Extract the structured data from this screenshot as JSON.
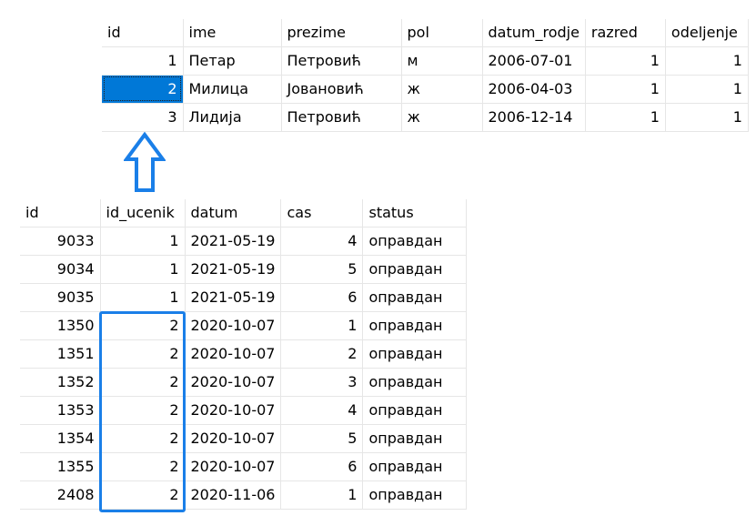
{
  "ucenici": {
    "columns": [
      "id",
      "ime",
      "prezime",
      "pol",
      "datum_rodje",
      "razred",
      "odeljenje"
    ],
    "rows": [
      [
        "1",
        "Петар",
        "Петровић",
        "м",
        "2006-07-01",
        "1",
        "1"
      ],
      [
        "2",
        "Милица",
        "Јовановић",
        "ж",
        "2006-04-03",
        "1",
        "1"
      ],
      [
        "3",
        "Лидија",
        "Петровић",
        "ж",
        "2006-12-14",
        "1",
        "1"
      ]
    ],
    "selected_cell": {
      "row": 1,
      "column": "id"
    }
  },
  "izostanci": {
    "columns": [
      "id",
      "id_ucenik",
      "datum",
      "cas",
      "status"
    ],
    "rows": [
      [
        "9033",
        "1",
        "2021-05-19",
        "4",
        "оправдан"
      ],
      [
        "9034",
        "1",
        "2021-05-19",
        "5",
        "оправдан"
      ],
      [
        "9035",
        "1",
        "2021-05-19",
        "6",
        "оправдан"
      ],
      [
        "1350",
        "2",
        "2020-10-07",
        "1",
        "оправдан"
      ],
      [
        "1351",
        "2",
        "2020-10-07",
        "2",
        "оправдан"
      ],
      [
        "1352",
        "2",
        "2020-10-07",
        "3",
        "оправдан"
      ],
      [
        "1353",
        "2",
        "2020-10-07",
        "4",
        "оправдан"
      ],
      [
        "1354",
        "2",
        "2020-10-07",
        "5",
        "оправдан"
      ],
      [
        "1355",
        "2",
        "2020-10-07",
        "6",
        "оправдан"
      ],
      [
        "2408",
        "2",
        "2020-11-06",
        "1",
        "оправдан"
      ]
    ]
  },
  "annotation": {
    "arrow_color": "#1a7fe8",
    "highlight_color": "#1a7fe8",
    "arrow_icon": "up-arrow-outline-icon"
  }
}
